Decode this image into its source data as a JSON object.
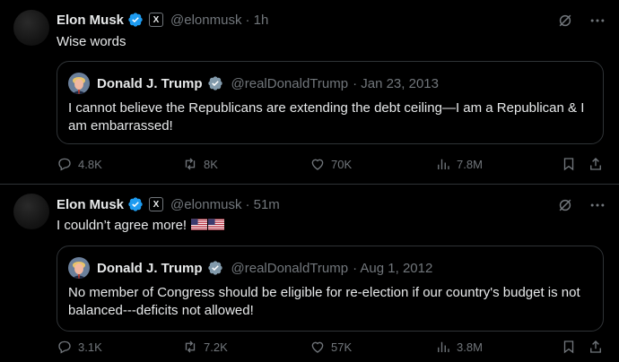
{
  "tweets": [
    {
      "author_name": "Elon Musk",
      "author_badge": "X",
      "author_handle": "@elonmusk",
      "time": "· 1h",
      "text": "Wise words",
      "flags": "",
      "quote": {
        "author_name": "Donald J. Trump",
        "author_handle": "@realDonaldTrump",
        "date": "· Jan 23, 2013",
        "text": "I cannot believe the Republicans are extending the debt ceiling—I am a Republican & I am embarrassed!"
      },
      "stats": {
        "replies": "4.8K",
        "reposts": "8K",
        "likes": "70K",
        "views": "7.8M"
      }
    },
    {
      "author_name": "Elon Musk",
      "author_badge": "X",
      "author_handle": "@elonmusk",
      "time": "· 51m",
      "text": "I couldn’t agree more!",
      "flags": "🇺🇸🇺🇸",
      "quote": {
        "author_name": "Donald J. Trump",
        "author_handle": "@realDonaldTrump",
        "date": "· Aug 1, 2012",
        "text": "No member of Congress should be eligible for re-election if our country's budget is not balanced---deficits not allowed!"
      },
      "stats": {
        "replies": "3.1K",
        "reposts": "7.2K",
        "likes": "57K",
        "views": "3.8M"
      }
    }
  ],
  "icons": [
    "verified-badge-icon",
    "grok-icon",
    "more-icon",
    "reply-icon",
    "repost-icon",
    "like-icon",
    "views-icon",
    "bookmark-icon",
    "share-icon"
  ],
  "colors": {
    "background": "#000000",
    "text": "#e7e9ea",
    "muted": "#71767b",
    "border": "#2f3336",
    "verified": "#1d9bf0"
  }
}
